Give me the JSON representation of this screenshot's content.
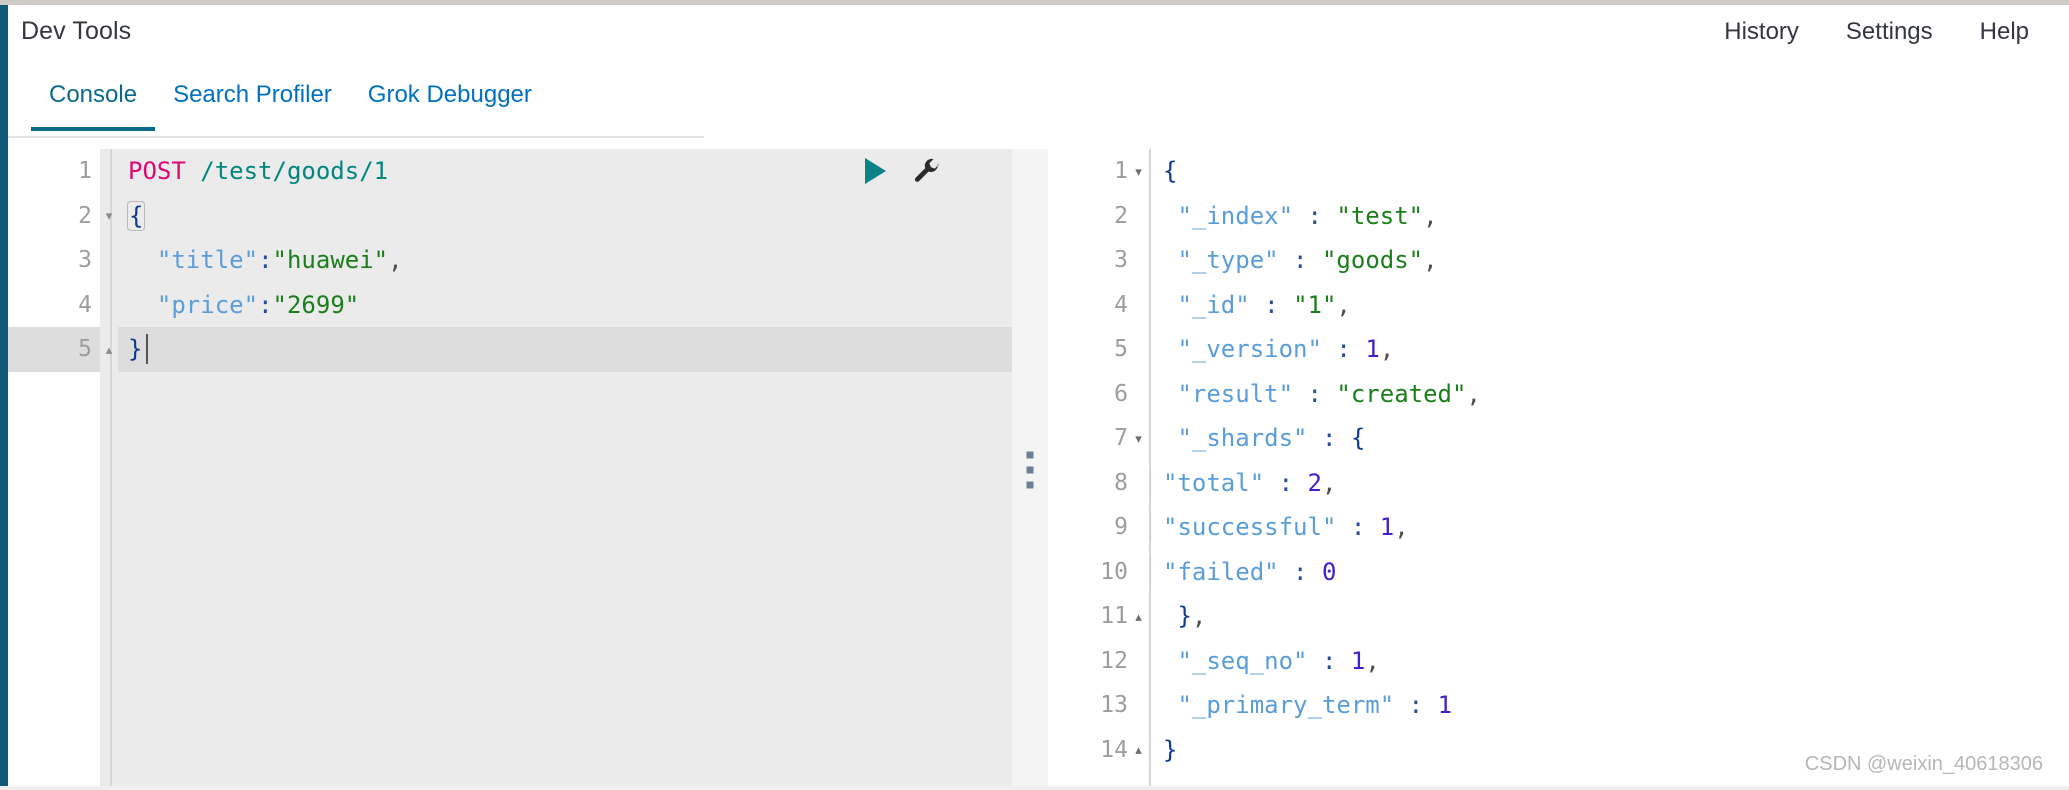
{
  "app": {
    "title": "Dev Tools",
    "accent_rail_color": "#0f5a78",
    "link_color": "#0071c2",
    "active_tab_color": "#0b6a8a"
  },
  "header": {
    "actions": [
      {
        "label": "History",
        "name": "history-button"
      },
      {
        "label": "Settings",
        "name": "settings-button"
      },
      {
        "label": "Help",
        "name": "help-button"
      }
    ]
  },
  "tabs": [
    {
      "label": "Console",
      "active": true
    },
    {
      "label": "Search Profiler",
      "active": false
    },
    {
      "label": "Grok Debugger",
      "active": false
    }
  ],
  "request_editor": {
    "icons": {
      "run": "play-icon",
      "settings": "wrench-icon"
    },
    "active_line": 5,
    "lines": [
      {
        "num": "1",
        "fold": "",
        "active": false,
        "tokens": [
          {
            "t": "POST",
            "c": "tk-method"
          },
          {
            "t": " ",
            "c": "tk-punct"
          },
          {
            "t": "/test/goods/1",
            "c": "tk-url"
          }
        ]
      },
      {
        "num": "2",
        "fold": "▾",
        "active": false,
        "tokens": [
          {
            "t": "{",
            "c": "tk-brace brace-box"
          }
        ]
      },
      {
        "num": "3",
        "fold": "",
        "active": false,
        "tokens": [
          {
            "t": "  ",
            "c": "tk-punct"
          },
          {
            "t": "\"title\"",
            "c": "tk-key"
          },
          {
            "t": ":",
            "c": "tk-colon"
          },
          {
            "t": "\"huawei\"",
            "c": "tk-str"
          },
          {
            "t": ",",
            "c": "tk-punct"
          }
        ]
      },
      {
        "num": "4",
        "fold": "",
        "active": false,
        "tokens": [
          {
            "t": "  ",
            "c": "tk-punct"
          },
          {
            "t": "\"price\"",
            "c": "tk-key"
          },
          {
            "t": ":",
            "c": "tk-colon"
          },
          {
            "t": "\"2699\"",
            "c": "tk-str"
          }
        ]
      },
      {
        "num": "5",
        "fold": "▴",
        "active": true,
        "tokens": [
          {
            "t": "}",
            "c": "tk-brace"
          }
        ],
        "caret": true
      }
    ],
    "raw_text": "POST /test/goods/1\n{\n  \"title\":\"huawei\",\n  \"price\":\"2699\"\n}"
  },
  "response_viewer": {
    "lines": [
      {
        "num": "1",
        "fold": "▾",
        "indent": false,
        "tokens": [
          {
            "t": "{",
            "c": "tk-brace"
          }
        ]
      },
      {
        "num": "2",
        "fold": "",
        "indent": false,
        "tokens": [
          {
            "t": " ",
            "c": "tk-punct"
          },
          {
            "t": "\"_index\"",
            "c": "tk-key"
          },
          {
            "t": " : ",
            "c": "tk-colon"
          },
          {
            "t": "\"test\"",
            "c": "tk-str"
          },
          {
            "t": ",",
            "c": "tk-punct"
          }
        ]
      },
      {
        "num": "3",
        "fold": "",
        "indent": false,
        "tokens": [
          {
            "t": " ",
            "c": "tk-punct"
          },
          {
            "t": "\"_type\"",
            "c": "tk-key"
          },
          {
            "t": " : ",
            "c": "tk-colon"
          },
          {
            "t": "\"goods\"",
            "c": "tk-str"
          },
          {
            "t": ",",
            "c": "tk-punct"
          }
        ]
      },
      {
        "num": "4",
        "fold": "",
        "indent": false,
        "tokens": [
          {
            "t": " ",
            "c": "tk-punct"
          },
          {
            "t": "\"_id\"",
            "c": "tk-key"
          },
          {
            "t": " : ",
            "c": "tk-colon"
          },
          {
            "t": "\"1\"",
            "c": "tk-str"
          },
          {
            "t": ",",
            "c": "tk-punct"
          }
        ]
      },
      {
        "num": "5",
        "fold": "",
        "indent": false,
        "tokens": [
          {
            "t": " ",
            "c": "tk-punct"
          },
          {
            "t": "\"_version\"",
            "c": "tk-key"
          },
          {
            "t": " : ",
            "c": "tk-colon"
          },
          {
            "t": "1",
            "c": "tk-num"
          },
          {
            "t": ",",
            "c": "tk-punct"
          }
        ]
      },
      {
        "num": "6",
        "fold": "",
        "indent": false,
        "tokens": [
          {
            "t": " ",
            "c": "tk-punct"
          },
          {
            "t": "\"result\"",
            "c": "tk-key"
          },
          {
            "t": " : ",
            "c": "tk-colon"
          },
          {
            "t": "\"created\"",
            "c": "tk-str"
          },
          {
            "t": ",",
            "c": "tk-punct"
          }
        ]
      },
      {
        "num": "7",
        "fold": "▾",
        "indent": false,
        "tokens": [
          {
            "t": " ",
            "c": "tk-punct"
          },
          {
            "t": "\"_shards\"",
            "c": "tk-key"
          },
          {
            "t": " : ",
            "c": "tk-colon"
          },
          {
            "t": "{",
            "c": "tk-brace"
          }
        ]
      },
      {
        "num": "8",
        "fold": "",
        "indent": true,
        "tokens": [
          {
            "t": "\"total\"",
            "c": "tk-key"
          },
          {
            "t": " : ",
            "c": "tk-colon"
          },
          {
            "t": "2",
            "c": "tk-num"
          },
          {
            "t": ",",
            "c": "tk-punct"
          }
        ]
      },
      {
        "num": "9",
        "fold": "",
        "indent": true,
        "tokens": [
          {
            "t": "\"successful\"",
            "c": "tk-key"
          },
          {
            "t": " : ",
            "c": "tk-colon"
          },
          {
            "t": "1",
            "c": "tk-num"
          },
          {
            "t": ",",
            "c": "tk-punct"
          }
        ]
      },
      {
        "num": "10",
        "fold": "",
        "indent": true,
        "tokens": [
          {
            "t": "\"failed\"",
            "c": "tk-key"
          },
          {
            "t": " : ",
            "c": "tk-colon"
          },
          {
            "t": "0",
            "c": "tk-num"
          }
        ]
      },
      {
        "num": "11",
        "fold": "▴",
        "indent": false,
        "tokens": [
          {
            "t": " ",
            "c": "tk-punct"
          },
          {
            "t": "}",
            "c": "tk-brace"
          },
          {
            "t": ",",
            "c": "tk-punct"
          }
        ]
      },
      {
        "num": "12",
        "fold": "",
        "indent": false,
        "tokens": [
          {
            "t": " ",
            "c": "tk-punct"
          },
          {
            "t": "\"_seq_no\"",
            "c": "tk-key"
          },
          {
            "t": " : ",
            "c": "tk-colon"
          },
          {
            "t": "1",
            "c": "tk-num"
          },
          {
            "t": ",",
            "c": "tk-punct"
          }
        ]
      },
      {
        "num": "13",
        "fold": "",
        "indent": false,
        "tokens": [
          {
            "t": " ",
            "c": "tk-punct"
          },
          {
            "t": "\"_primary_term\"",
            "c": "tk-key"
          },
          {
            "t": " : ",
            "c": "tk-colon"
          },
          {
            "t": "1",
            "c": "tk-num"
          }
        ]
      },
      {
        "num": "14",
        "fold": "▴",
        "indent": false,
        "tokens": [
          {
            "t": "}",
            "c": "tk-brace"
          }
        ]
      }
    ],
    "raw_json": {
      "_index": "test",
      "_type": "goods",
      "_id": "1",
      "_version": 1,
      "result": "created",
      "_shards": {
        "total": 2,
        "successful": 1,
        "failed": 0
      },
      "_seq_no": 1,
      "_primary_term": 1
    }
  },
  "watermark": {
    "text": "CSDN @weixin_40618306"
  }
}
